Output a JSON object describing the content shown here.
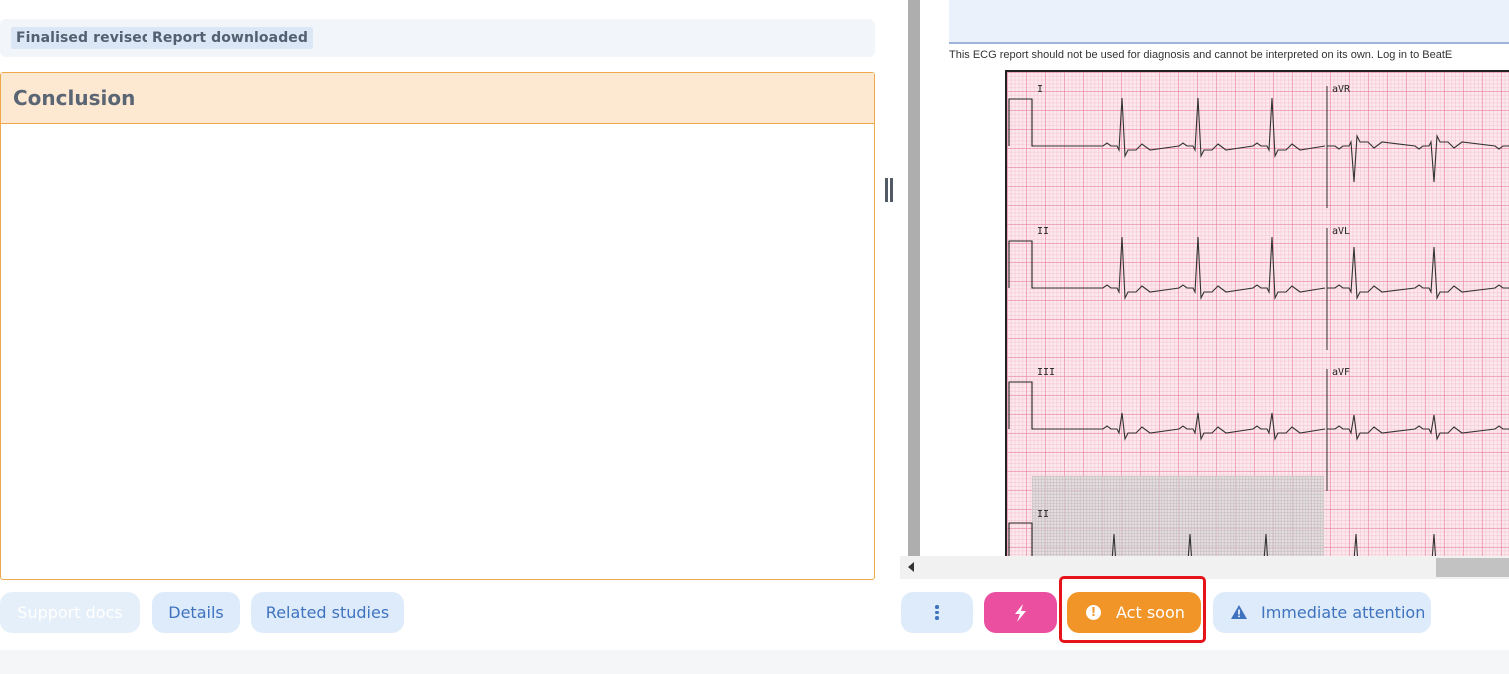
{
  "tags": {
    "finalised_revised": "Finalised revised",
    "report_downloaded": "Report downloaded"
  },
  "conclusion": {
    "title": "Conclusion",
    "text": ""
  },
  "left_actions": {
    "support_docs": "Support docs",
    "details": "Details",
    "related_studies": "Related studies"
  },
  "report": {
    "disclaimer": "This ECG report should not be used for diagnosis and cannot be interpreted on its own. Log in to BeatE",
    "leads": [
      "I",
      "aVR",
      "II",
      "aVL",
      "III",
      "aVF",
      "II"
    ]
  },
  "right_actions": {
    "more_icon": "vertical-ellipsis-icon",
    "flash_icon": "lightning-bolt-icon",
    "act_soon": "Act soon",
    "act_soon_icon": "exclamation-circle-icon",
    "immediate_attention": "Immediate attention",
    "immediate_icon": "warning-triangle-icon"
  },
  "colors": {
    "act_soon": "#f29528",
    "flash": "#eb4fa0",
    "highlight": "#e5141b",
    "accent_blue": "#3f73bf"
  }
}
